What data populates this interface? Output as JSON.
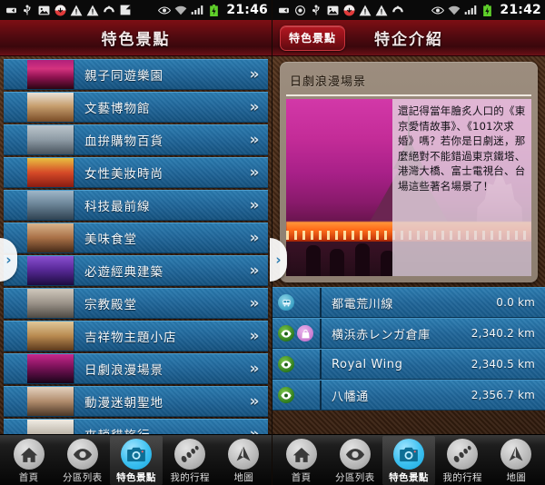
{
  "statusbar": {
    "left_time": "21:46",
    "right_time": "21:42",
    "icons_left": [
      "adb-icon",
      "usb-icon",
      "image-icon",
      "download-icon",
      "warning-icon",
      "warning-icon",
      "sync-icon",
      "app-icon"
    ],
    "icons_left_right": [
      "usb-debug-eye-icon",
      "wifi-icon",
      "signal-icon",
      "battery-icon"
    ],
    "icons_right": [
      "adb-icon",
      "gps-icon",
      "usb-icon",
      "image-icon",
      "download-icon",
      "warning-icon",
      "warning-icon",
      "sync-icon"
    ],
    "icons_right_right": [
      "usb-debug-eye-icon",
      "wifi-icon",
      "signal-icon",
      "battery-icon"
    ]
  },
  "left_pane": {
    "title": "特色景點",
    "edge_arrow": "›",
    "list": [
      {
        "label": "親子同遊樂園",
        "chevron": "»",
        "thumb": "th-a"
      },
      {
        "label": "文藝博物館",
        "chevron": "»",
        "thumb": "th-b"
      },
      {
        "label": "血拚購物百貨",
        "chevron": "»",
        "thumb": "th-c"
      },
      {
        "label": "女性美妝時尚",
        "chevron": "»",
        "thumb": "th-d"
      },
      {
        "label": "科技最前線",
        "chevron": "»",
        "thumb": "th-e"
      },
      {
        "label": "美味食堂",
        "chevron": "»",
        "thumb": "th-f"
      },
      {
        "label": "必遊經典建築",
        "chevron": "»",
        "thumb": "th-g"
      },
      {
        "label": "宗教殿堂",
        "chevron": "»",
        "thumb": "th-h"
      },
      {
        "label": "吉祥物主題小店",
        "chevron": "»",
        "thumb": "th-i"
      },
      {
        "label": "日劇浪漫場景",
        "chevron": "»",
        "thumb": "th-j"
      },
      {
        "label": "動漫迷朝聖地",
        "chevron": "»",
        "thumb": "th-k"
      },
      {
        "label": "來趟貓旅行",
        "chevron": "»",
        "thumb": "th-l"
      }
    ]
  },
  "right_pane": {
    "badge": "特色景點",
    "title": "特企介紹",
    "edge_arrow": "›",
    "card": {
      "heading": "日劇浪漫場景",
      "description": "還記得當年膾炙人口的《東京愛情故事》、《101次求婚》嗎？若你是日劇迷，那麼絕對不能錯過東京鐵塔、港灣大橋、富士電視台、台場這些著名場景了！"
    },
    "places": [
      {
        "name": "都電荒川線",
        "distance": "0.0 km",
        "icons": [
          "tram-icon"
        ]
      },
      {
        "name": "横浜赤レンガ倉庫",
        "distance": "2,340.2 km",
        "icons": [
          "eye-icon",
          "bag-icon"
        ]
      },
      {
        "name": "Royal Wing",
        "distance": "2,340.5 km",
        "icons": [
          "eye-icon"
        ]
      },
      {
        "name": "八幡通",
        "distance": "2,356.7 km",
        "icons": [
          "eye-icon"
        ]
      }
    ]
  },
  "navbar": {
    "items": [
      {
        "label": "首頁",
        "icon": "home-icon",
        "active": false
      },
      {
        "label": "分區列表",
        "icon": "eye-icon",
        "active": false
      },
      {
        "label": "特色景點",
        "icon": "camera-icon",
        "active": true
      },
      {
        "label": "我的行程",
        "icon": "footprint-icon",
        "active": false
      },
      {
        "label": "地圖",
        "icon": "compass-icon",
        "active": false
      }
    ]
  },
  "colors": {
    "header_red": "#7e0f14",
    "row_blue": "#1f6497",
    "accent_cyan": "#3cc0f0",
    "background_brown": "#4a2c18"
  }
}
